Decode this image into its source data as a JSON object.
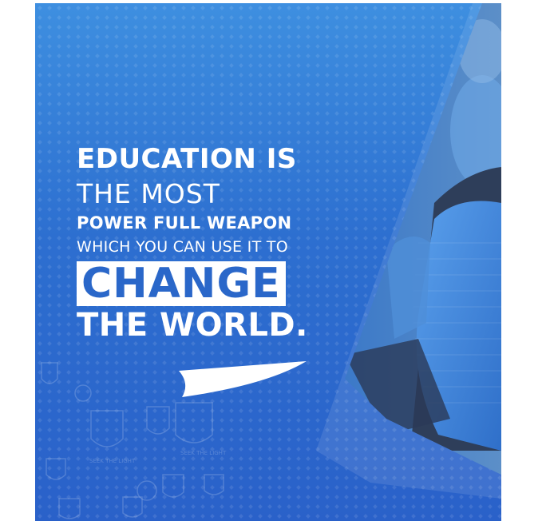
{
  "headline": {
    "line1": "EDUCATION IS",
    "line2": "THE MOST",
    "line3": "POWER FULL WEAPON",
    "line4": "WHICH YOU CAN USE IT TO",
    "line5": "CHANGE",
    "line6": "THE WORLD."
  },
  "watermark": {
    "motto_text": "SEEK THE LIGHT"
  },
  "colors": {
    "background_blue": "#2d6fd0",
    "highlight_text": "#2a67c9",
    "shirt_blue": "#4a90e2",
    "text": "#ffffff"
  },
  "icons": [
    "school-crest-icon",
    "quote-tail-icon"
  ]
}
